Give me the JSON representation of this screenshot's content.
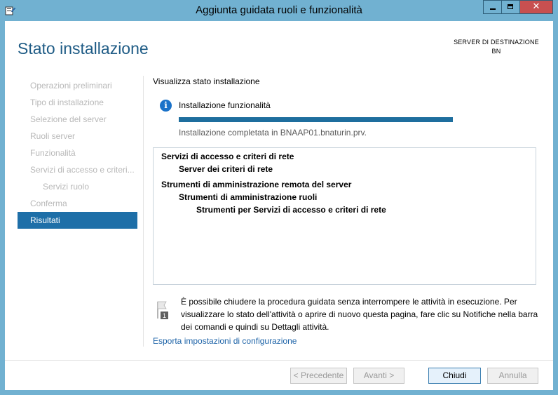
{
  "window": {
    "title": "Aggiunta guidata ruoli e funzionalità",
    "close_glyph": "✕"
  },
  "header": {
    "title": "Stato installazione",
    "destination_label": "SERVER DI DESTINAZIONE",
    "destination_value": "BN"
  },
  "nav": {
    "items": [
      {
        "label": "Operazioni preliminari",
        "state": "disabled"
      },
      {
        "label": "Tipo di installazione",
        "state": "disabled"
      },
      {
        "label": "Selezione del server",
        "state": "disabled"
      },
      {
        "label": "Ruoli server",
        "state": "disabled"
      },
      {
        "label": "Funzionalità",
        "state": "disabled"
      },
      {
        "label": "Servizi di accesso e criteri...",
        "state": "disabled"
      },
      {
        "label": "Servizi ruolo",
        "state": "disabled"
      },
      {
        "label": "Conferma",
        "state": "disabled"
      },
      {
        "label": "Risultati",
        "state": "active"
      }
    ]
  },
  "main": {
    "section_label": "Visualizza stato installazione",
    "status": {
      "icon": "info-icon",
      "title": "Installazione funzionalità",
      "progress": 1.0,
      "detail": "Installazione completata in BNAAP01.bnaturin.prv."
    },
    "results": [
      {
        "text": "Servizi di accesso e criteri di rete",
        "level": 0
      },
      {
        "text": "Server dei criteri di rete",
        "level": 1
      },
      {
        "text": "Strumenti di amministrazione remota del server",
        "level": 0
      },
      {
        "text": "Strumenti di amministrazione ruoli",
        "level": 1
      },
      {
        "text": "Strumenti per Servizi di accesso e criteri di rete",
        "level": 2
      }
    ],
    "note": {
      "icon": "notification-flag-icon",
      "badge": "1",
      "lines": [
        "È possibile chiudere la procedura guidata senza interrompere le attività in esecuzione. Per",
        "visualizzare lo stato dell'attività o aprire di nuovo questa pagina, fare clic su Notifiche nella barra",
        "dei comandi e quindi su Dettagli attività."
      ]
    },
    "export_link": "Esporta impostazioni di configurazione"
  },
  "footer": {
    "prev": "< Precedente",
    "next": "Avanti >",
    "close": "Chiudi",
    "cancel": "Annulla"
  },
  "colors": {
    "titlebar": "#71b1d1",
    "accent": "#1e6fa8",
    "header_title": "#1e5b85",
    "progress": "#1e6e9e",
    "close_button": "#c75050"
  }
}
